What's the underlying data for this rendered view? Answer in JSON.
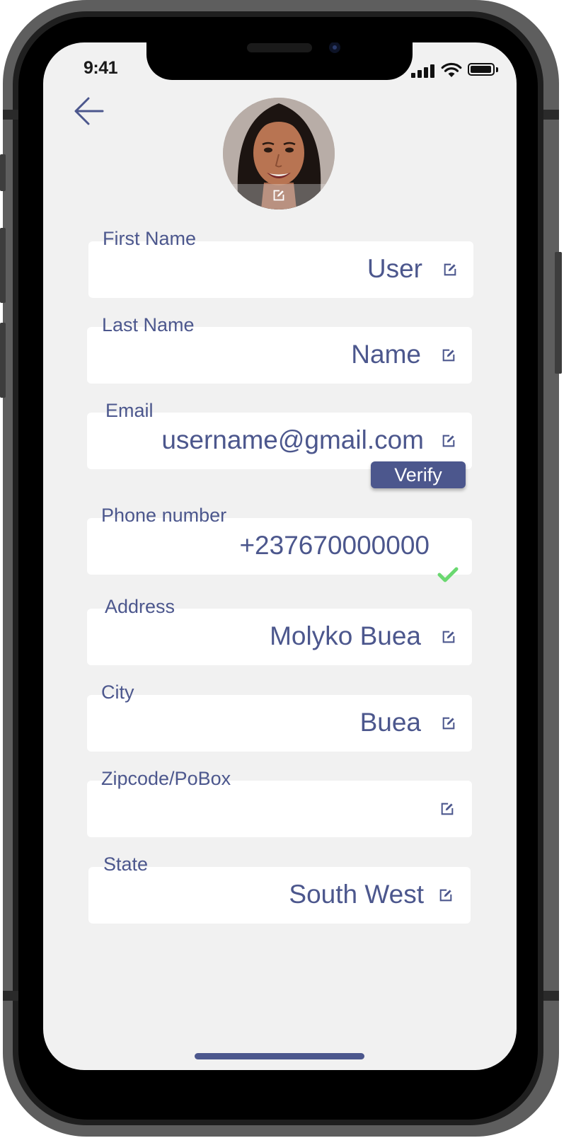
{
  "status_bar": {
    "time": "9:41"
  },
  "colors": {
    "accent": "#4c578d",
    "screen_bg": "#f1f1f1",
    "field_bg": "#ffffff",
    "success": "#6ad870"
  },
  "header": {
    "back_icon": "arrow-left-icon",
    "avatar_edit_icon": "edit-icon"
  },
  "fields": {
    "first_name": {
      "label": "First Name",
      "value": "User"
    },
    "last_name": {
      "label": "Last Name",
      "value": "Name"
    },
    "email": {
      "label": "Email",
      "value": "username@gmail.com",
      "verify_label": "Verify"
    },
    "phone": {
      "label": "Phone number",
      "value": "+237670000000",
      "status_icon": "checkmark-icon"
    },
    "address": {
      "label": "Address",
      "value": "Molyko Buea"
    },
    "city": {
      "label": "City",
      "value": "Buea"
    },
    "zipcode": {
      "label": "Zipcode/PoBox",
      "value": ""
    },
    "state": {
      "label": "State",
      "value": "South West"
    }
  }
}
